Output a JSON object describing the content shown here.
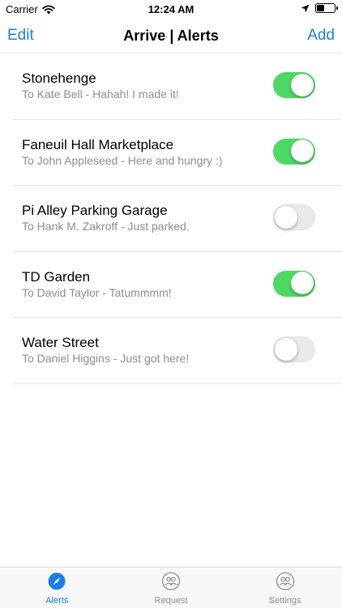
{
  "status_bar": {
    "carrier": "Carrier",
    "time": "12:24 AM",
    "battery_level": 0.45
  },
  "nav": {
    "left_label": "Edit",
    "title": "Arrive | Alerts",
    "right_label": "Add"
  },
  "alerts": [
    {
      "title": "Stonehenge",
      "subtitle": "To Kate Bell - Hahah! I made it!",
      "enabled": true
    },
    {
      "title": "Faneuil Hall Marketplace",
      "subtitle": "To John Appleseed - Here and hungry :)",
      "enabled": true
    },
    {
      "title": "Pi Alley Parking Garage",
      "subtitle": "To Hank M. Zakroff - Just parked.",
      "enabled": false
    },
    {
      "title": "TD Garden",
      "subtitle": "To David Taylor - Tatummmm!",
      "enabled": true
    },
    {
      "title": "Water Street",
      "subtitle": "To Daniel Higgins - Just got here!",
      "enabled": false
    }
  ],
  "tabs": [
    {
      "label": "Alerts",
      "icon": "compass-icon",
      "active": true
    },
    {
      "label": "Request",
      "icon": "people-circle-icon",
      "active": false
    },
    {
      "label": "Settings",
      "icon": "people-circle-icon",
      "active": false
    }
  ],
  "colors": {
    "accent": "#1a7ee6",
    "toggle_on": "#4cd964",
    "toggle_off": "#e9e9ea",
    "subtitle": "#8e8e93"
  }
}
